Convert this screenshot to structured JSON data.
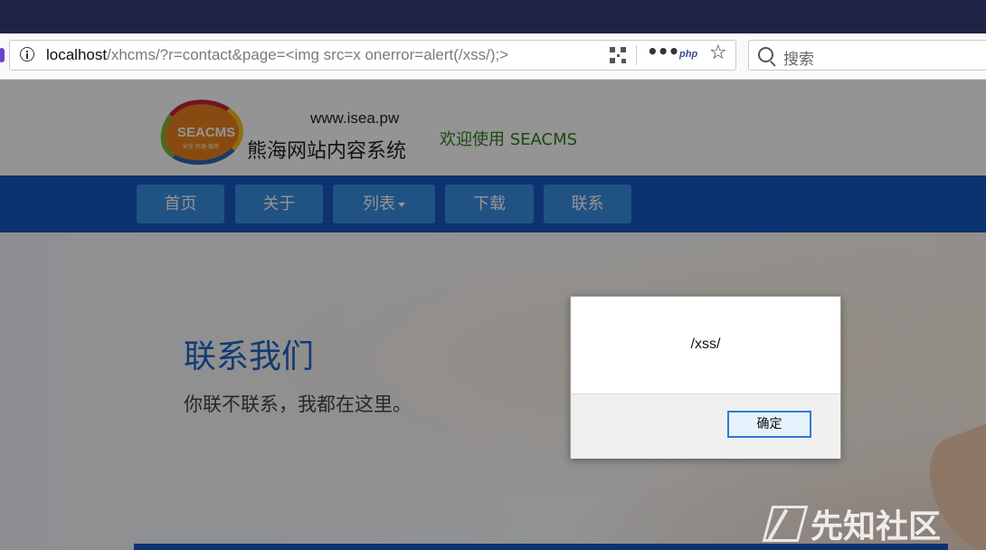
{
  "browser": {
    "url_host": "localhost",
    "url_rest": "/xhcms/?r=contact&page=<img src=x onerror=alert(/xss/);>",
    "php_badge": "php",
    "more_glyph": "•••",
    "star_glyph": "☆",
    "search_placeholder": "搜索"
  },
  "site": {
    "logo_badge_text": "SEACMS",
    "logo_badge_sub": "安全·开源·极简",
    "logo_domain": "www.isea.pw",
    "logo_name": "熊海网站内容系统",
    "welcome": "欢迎使用 SEACMS",
    "nav": [
      {
        "label": "首页"
      },
      {
        "label": "关于"
      },
      {
        "label": "列表"
      },
      {
        "label": "下载"
      },
      {
        "label": "联系"
      }
    ],
    "hero_title": "联系我们",
    "hero_subtitle": "你联不联系，我都在这里。"
  },
  "dialog": {
    "message": "/xss/",
    "ok_label": "确定"
  },
  "watermark": {
    "text": "先知社区"
  },
  "colors": {
    "titlebar": "#1f2446",
    "nav_bar": "#1558c0",
    "nav_item": "#3a8de3",
    "welcome_text": "#2e7d1a",
    "hero_title": "#1e64c8"
  }
}
